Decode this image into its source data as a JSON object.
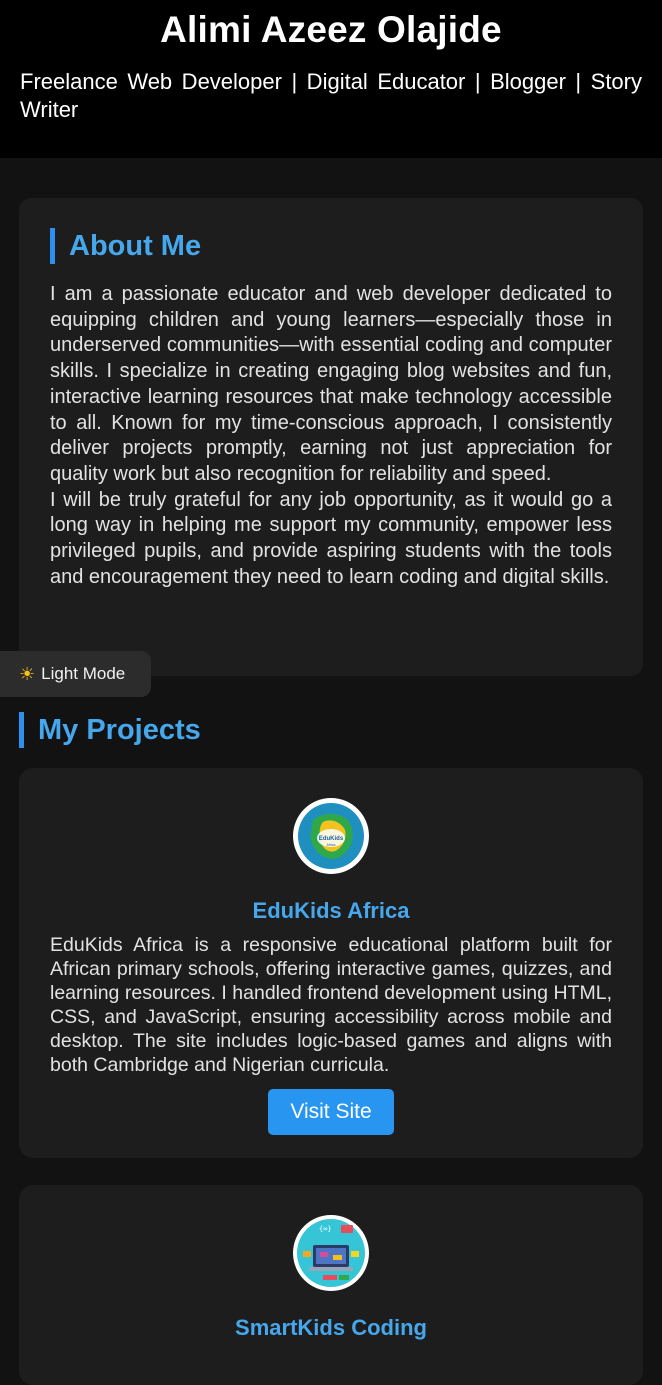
{
  "header": {
    "name": "Alimi Azeez Olajide",
    "tagline": "Freelance Web Developer | Digital Educator | Blogger | Story Writer"
  },
  "about": {
    "heading": "About Me",
    "paragraph_1": "I am a passionate educator and web developer dedicated to equipping children and young learners—especially those in underserved communities—with essential coding and computer skills. I specialize in creating engaging blog websites and fun, interactive learning resources that make technology accessible to all. Known for my time-conscious approach, I consistently deliver projects promptly, earning not just appreciation for quality work but also recognition for reliability and speed.",
    "paragraph_2": "I will be truly grateful for any job opportunity, as it would go a long way in helping me support my community, empower less privileged pupils, and provide aspiring students with the tools and encouragement they need to learn coding and digital skills."
  },
  "theme_toggle": {
    "icon": "sun-icon",
    "label": "Light Mode"
  },
  "projects": {
    "heading": "My Projects",
    "items": [
      {
        "title": "EduKids Africa",
        "logo_text": "EduKids Africa",
        "description": "EduKids Africa is a responsive educational platform built for African primary schools, offering interactive games, quizzes, and learning resources. I handled frontend development using HTML, CSS, and JavaScript, ensuring accessibility across mobile and desktop. The site includes logic-based games and aligns with both Cambridge and Nigerian curricula.",
        "button_label": "Visit Site"
      },
      {
        "title": "SmartKids Coding"
      }
    ]
  },
  "colors": {
    "accent": "#46a7ec",
    "button": "#2896f0",
    "card": "#1d1d1d",
    "background": "#121212",
    "header": "#000000"
  }
}
